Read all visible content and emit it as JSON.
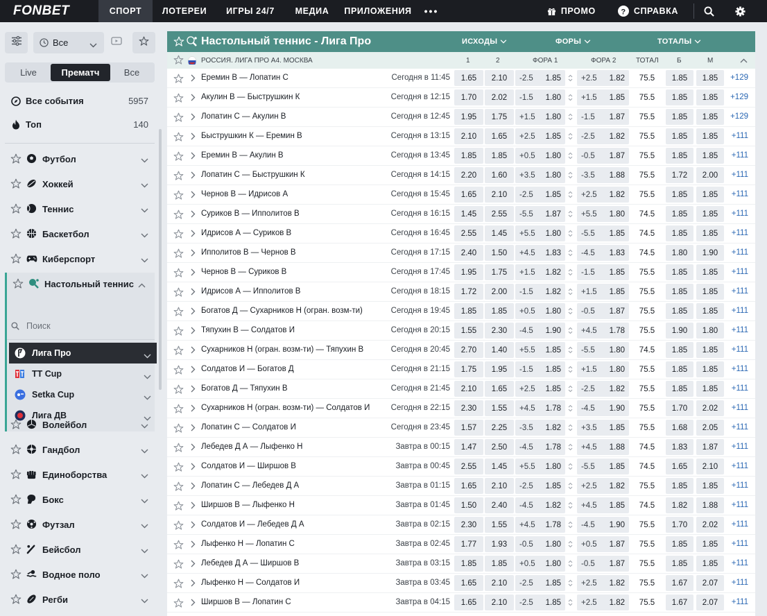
{
  "brand": "FONBET",
  "nav": {
    "items": [
      "СПОРТ",
      "ЛОТЕРЕИ",
      "ИГРЫ 24/7",
      "МЕДИА",
      "ПРИЛОЖЕНИЯ"
    ],
    "more": "•••",
    "promo": "ПРОМО",
    "help": "СПРАВКА"
  },
  "sidebar": {
    "filter_value": "Все",
    "tabs": [
      "Live",
      "Прематч",
      "Все"
    ],
    "all_events": {
      "label": "Все события",
      "count": "5957"
    },
    "top": {
      "label": "Топ",
      "count": "140"
    },
    "sports_a": [
      "Футбол",
      "Хоккей",
      "Теннис",
      "Баскетбол",
      "Киберспорт"
    ],
    "table_tennis": "Настольный теннис",
    "search_placeholder": "Поиск",
    "leagues": [
      "Лига Про",
      "TT Cup",
      "Setka Cup",
      "Лига ДВ"
    ],
    "sports_b": [
      "Волейбол",
      "Гандбол",
      "Единоборства",
      "Бокс",
      "Футзал",
      "Бейсбол",
      "Водное поло",
      "Регби"
    ]
  },
  "main": {
    "title": "Настольный теннис - Лига Про",
    "col_groups": [
      "ИСХОДЫ",
      "ФОРЫ",
      "ТОТАЛЫ"
    ],
    "region": "РОССИЯ. ЛИГА ПРО А4. МОСКВА",
    "col_heads": [
      "1",
      "2",
      "ФОРА 1",
      "ФОРА 2",
      "ТОТАЛ",
      "Б",
      "М"
    ],
    "matches": [
      {
        "teams": "Еремин В — Лопатин С",
        "time": "Сегодня в 11:45",
        "o1": "1.65",
        "o2": "2.10",
        "f1h": "-2.5",
        "f1": "1.85",
        "f2h": "+2.5",
        "f2": "1.82",
        "tot": "75.5",
        "b": "1.85",
        "m": "1.85",
        "more": "+129"
      },
      {
        "teams": "Акулин В — Быструшкин К",
        "time": "Сегодня в 12:15",
        "o1": "1.70",
        "o2": "2.02",
        "f1h": "-1.5",
        "f1": "1.80",
        "f2h": "+1.5",
        "f2": "1.85",
        "tot": "75.5",
        "b": "1.85",
        "m": "1.85",
        "more": "+129"
      },
      {
        "teams": "Лопатин С — Акулин В",
        "time": "Сегодня в 12:45",
        "o1": "1.95",
        "o2": "1.75",
        "f1h": "+1.5",
        "f1": "1.80",
        "f2h": "-1.5",
        "f2": "1.87",
        "tot": "75.5",
        "b": "1.85",
        "m": "1.85",
        "more": "+129"
      },
      {
        "teams": "Быструшкин К — Еремин В",
        "time": "Сегодня в 13:15",
        "o1": "2.10",
        "o2": "1.65",
        "f1h": "+2.5",
        "f1": "1.85",
        "f2h": "-2.5",
        "f2": "1.82",
        "tot": "75.5",
        "b": "1.85",
        "m": "1.85",
        "more": "+111"
      },
      {
        "teams": "Еремин В — Акулин В",
        "time": "Сегодня в 13:45",
        "o1": "1.85",
        "o2": "1.85",
        "f1h": "+0.5",
        "f1": "1.80",
        "f2h": "-0.5",
        "f2": "1.87",
        "tot": "75.5",
        "b": "1.85",
        "m": "1.85",
        "more": "+111"
      },
      {
        "teams": "Лопатин С — Быструшкин К",
        "time": "Сегодня в 14:15",
        "o1": "2.20",
        "o2": "1.60",
        "f1h": "+3.5",
        "f1": "1.80",
        "f2h": "-3.5",
        "f2": "1.88",
        "tot": "75.5",
        "b": "1.72",
        "m": "2.00",
        "more": "+111"
      },
      {
        "teams": "Чернов В — Идрисов А",
        "time": "Сегодня в 15:45",
        "o1": "1.65",
        "o2": "2.10",
        "f1h": "-2.5",
        "f1": "1.85",
        "f2h": "+2.5",
        "f2": "1.82",
        "tot": "75.5",
        "b": "1.85",
        "m": "1.85",
        "more": "+111"
      },
      {
        "teams": "Суриков В — Ипполитов В",
        "time": "Сегодня в 16:15",
        "o1": "1.45",
        "o2": "2.55",
        "f1h": "-5.5",
        "f1": "1.87",
        "f2h": "+5.5",
        "f2": "1.80",
        "tot": "74.5",
        "b": "1.85",
        "m": "1.85",
        "more": "+111"
      },
      {
        "teams": "Идрисов А — Суриков В",
        "time": "Сегодня в 16:45",
        "o1": "2.55",
        "o2": "1.45",
        "f1h": "+5.5",
        "f1": "1.80",
        "f2h": "-5.5",
        "f2": "1.85",
        "tot": "74.5",
        "b": "1.85",
        "m": "1.85",
        "more": "+111"
      },
      {
        "teams": "Ипполитов В — Чернов В",
        "time": "Сегодня в 17:15",
        "o1": "2.40",
        "o2": "1.50",
        "f1h": "+4.5",
        "f1": "1.83",
        "f2h": "-4.5",
        "f2": "1.83",
        "tot": "74.5",
        "b": "1.80",
        "m": "1.90",
        "more": "+111"
      },
      {
        "teams": "Чернов В — Суриков В",
        "time": "Сегодня в 17:45",
        "o1": "1.95",
        "o2": "1.75",
        "f1h": "+1.5",
        "f1": "1.82",
        "f2h": "-1.5",
        "f2": "1.85",
        "tot": "75.5",
        "b": "1.85",
        "m": "1.85",
        "more": "+111"
      },
      {
        "teams": "Идрисов А — Ипполитов В",
        "time": "Сегодня в 18:15",
        "o1": "1.72",
        "o2": "2.00",
        "f1h": "-1.5",
        "f1": "1.82",
        "f2h": "+1.5",
        "f2": "1.85",
        "tot": "75.5",
        "b": "1.85",
        "m": "1.85",
        "more": "+111"
      },
      {
        "teams": "Богатов Д — Сухарников Н (огран. возм-ти)",
        "time": "Сегодня в 19:45",
        "o1": "1.85",
        "o2": "1.85",
        "f1h": "+0.5",
        "f1": "1.80",
        "f2h": "-0.5",
        "f2": "1.87",
        "tot": "75.5",
        "b": "1.85",
        "m": "1.85",
        "more": "+111"
      },
      {
        "teams": "Тяпухин В — Солдатов И",
        "time": "Сегодня в 20:15",
        "o1": "1.55",
        "o2": "2.30",
        "f1h": "-4.5",
        "f1": "1.90",
        "f2h": "+4.5",
        "f2": "1.78",
        "tot": "75.5",
        "b": "1.90",
        "m": "1.80",
        "more": "+111"
      },
      {
        "teams": "Сухарников Н (огран. возм-ти) — Тяпухин В",
        "time": "Сегодня в 20:45",
        "o1": "2.70",
        "o2": "1.40",
        "f1h": "+5.5",
        "f1": "1.85",
        "f2h": "-5.5",
        "f2": "1.80",
        "tot": "74.5",
        "b": "1.85",
        "m": "1.85",
        "more": "+111"
      },
      {
        "teams": "Солдатов И — Богатов Д",
        "time": "Сегодня в 21:15",
        "o1": "1.75",
        "o2": "1.95",
        "f1h": "-1.5",
        "f1": "1.85",
        "f2h": "+1.5",
        "f2": "1.80",
        "tot": "75.5",
        "b": "1.85",
        "m": "1.85",
        "more": "+111"
      },
      {
        "teams": "Богатов Д — Тяпухин В",
        "time": "Сегодня в 21:45",
        "o1": "2.10",
        "o2": "1.65",
        "f1h": "+2.5",
        "f1": "1.85",
        "f2h": "-2.5",
        "f2": "1.82",
        "tot": "75.5",
        "b": "1.85",
        "m": "1.85",
        "more": "+111"
      },
      {
        "teams": "Сухарников Н (огран. возм-ти) — Солдатов И",
        "time": "Сегодня в 22:15",
        "o1": "2.30",
        "o2": "1.55",
        "f1h": "+4.5",
        "f1": "1.78",
        "f2h": "-4.5",
        "f2": "1.90",
        "tot": "75.5",
        "b": "1.70",
        "m": "2.02",
        "more": "+111"
      },
      {
        "teams": "Лопатин С — Солдатов И",
        "time": "Сегодня в 23:45",
        "o1": "1.57",
        "o2": "2.25",
        "f1h": "-3.5",
        "f1": "1.82",
        "f2h": "+3.5",
        "f2": "1.85",
        "tot": "75.5",
        "b": "1.68",
        "m": "2.05",
        "more": "+111"
      },
      {
        "teams": "Лебедев Д А — Лыфенко Н",
        "time": "Завтра в 00:15",
        "o1": "1.47",
        "o2": "2.50",
        "f1h": "-4.5",
        "f1": "1.78",
        "f2h": "+4.5",
        "f2": "1.88",
        "tot": "74.5",
        "b": "1.83",
        "m": "1.87",
        "more": "+111"
      },
      {
        "teams": "Солдатов И — Ширшов В",
        "time": "Завтра в 00:45",
        "o1": "2.55",
        "o2": "1.45",
        "f1h": "+5.5",
        "f1": "1.80",
        "f2h": "-5.5",
        "f2": "1.85",
        "tot": "74.5",
        "b": "1.65",
        "m": "2.10",
        "more": "+111"
      },
      {
        "teams": "Лопатин С — Лебедев Д А",
        "time": "Завтра в 01:15",
        "o1": "1.65",
        "o2": "2.10",
        "f1h": "-2.5",
        "f1": "1.85",
        "f2h": "+2.5",
        "f2": "1.82",
        "tot": "75.5",
        "b": "1.85",
        "m": "1.85",
        "more": "+111"
      },
      {
        "teams": "Ширшов В — Лыфенко Н",
        "time": "Завтра в 01:45",
        "o1": "1.50",
        "o2": "2.40",
        "f1h": "-4.5",
        "f1": "1.82",
        "f2h": "+4.5",
        "f2": "1.85",
        "tot": "74.5",
        "b": "1.82",
        "m": "1.88",
        "more": "+111"
      },
      {
        "teams": "Солдатов И — Лебедев Д А",
        "time": "Завтра в 02:15",
        "o1": "2.30",
        "o2": "1.55",
        "f1h": "+4.5",
        "f1": "1.78",
        "f2h": "-4.5",
        "f2": "1.90",
        "tot": "75.5",
        "b": "1.70",
        "m": "2.02",
        "more": "+111"
      },
      {
        "teams": "Лыфенко Н — Лопатин С",
        "time": "Завтра в 02:45",
        "o1": "1.77",
        "o2": "1.93",
        "f1h": "-0.5",
        "f1": "1.80",
        "f2h": "+0.5",
        "f2": "1.87",
        "tot": "75.5",
        "b": "1.85",
        "m": "1.85",
        "more": "+111"
      },
      {
        "teams": "Лебедев Д А — Ширшов В",
        "time": "Завтра в 03:15",
        "o1": "1.85",
        "o2": "1.85",
        "f1h": "+0.5",
        "f1": "1.80",
        "f2h": "-0.5",
        "f2": "1.87",
        "tot": "75.5",
        "b": "1.85",
        "m": "1.85",
        "more": "+111"
      },
      {
        "teams": "Лыфенко Н — Солдатов И",
        "time": "Завтра в 03:45",
        "o1": "1.65",
        "o2": "2.10",
        "f1h": "-2.5",
        "f1": "1.85",
        "f2h": "+2.5",
        "f2": "1.82",
        "tot": "75.5",
        "b": "1.67",
        "m": "2.07",
        "more": "+111"
      },
      {
        "teams": "Ширшов В — Лопатин С",
        "time": "Завтра в 04:15",
        "o1": "1.65",
        "o2": "2.10",
        "f1h": "-2.5",
        "f1": "1.85",
        "f2h": "+2.5",
        "f2": "1.82",
        "tot": "75.5",
        "b": "1.67",
        "m": "2.07",
        "more": "+111"
      }
    ]
  },
  "colors": {
    "accent": "#4e8f87",
    "nav_bg": "#1b1d22",
    "link": "#2a67b3"
  }
}
